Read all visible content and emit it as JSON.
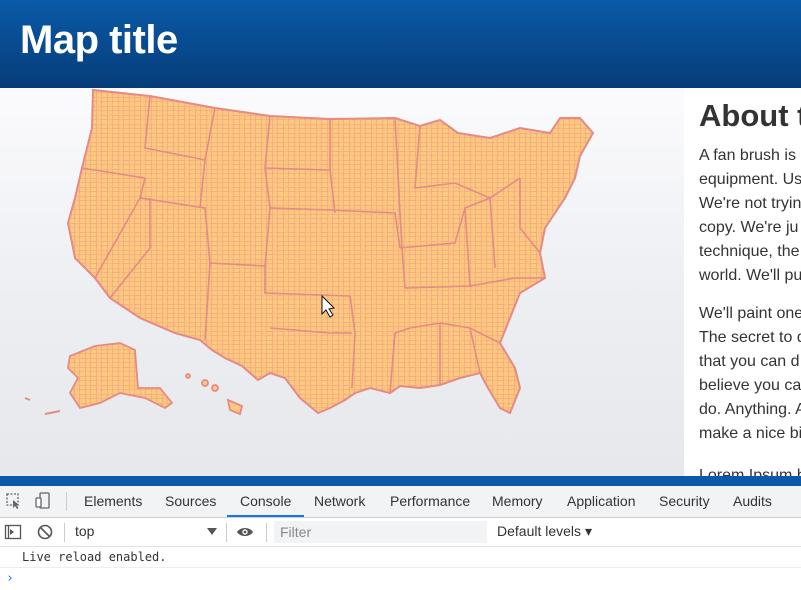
{
  "header": {
    "title": "Map title"
  },
  "about": {
    "heading": "About t",
    "paragraph1": [
      "A fan brush is",
      "equipment. Us",
      "We're not tryin",
      "copy. We're ju",
      "technique, the",
      "world. We'll pu"
    ],
    "paragraph2": [
      "We'll paint one",
      "The secret to d",
      "that you can d",
      "believe you ca",
      "do. Anything. A",
      "make a nice bi"
    ],
    "paragraph3": [
      "Lorem Ipsum b"
    ]
  },
  "devtools": {
    "tabs": [
      "Elements",
      "Sources",
      "Console",
      "Network",
      "Performance",
      "Memory",
      "Application",
      "Security",
      "Audits"
    ],
    "active_tab": "Console",
    "context": "top",
    "filter_placeholder": "Filter",
    "levels": "Default levels",
    "levels_arrow": "▾",
    "log_message": "Live reload enabled.",
    "prompt": "›"
  },
  "colors": {
    "header": "#0a5aa8",
    "map_fill": "#fdc97f",
    "map_stroke": "#e58a85",
    "active_tab": "#1a73e8"
  }
}
